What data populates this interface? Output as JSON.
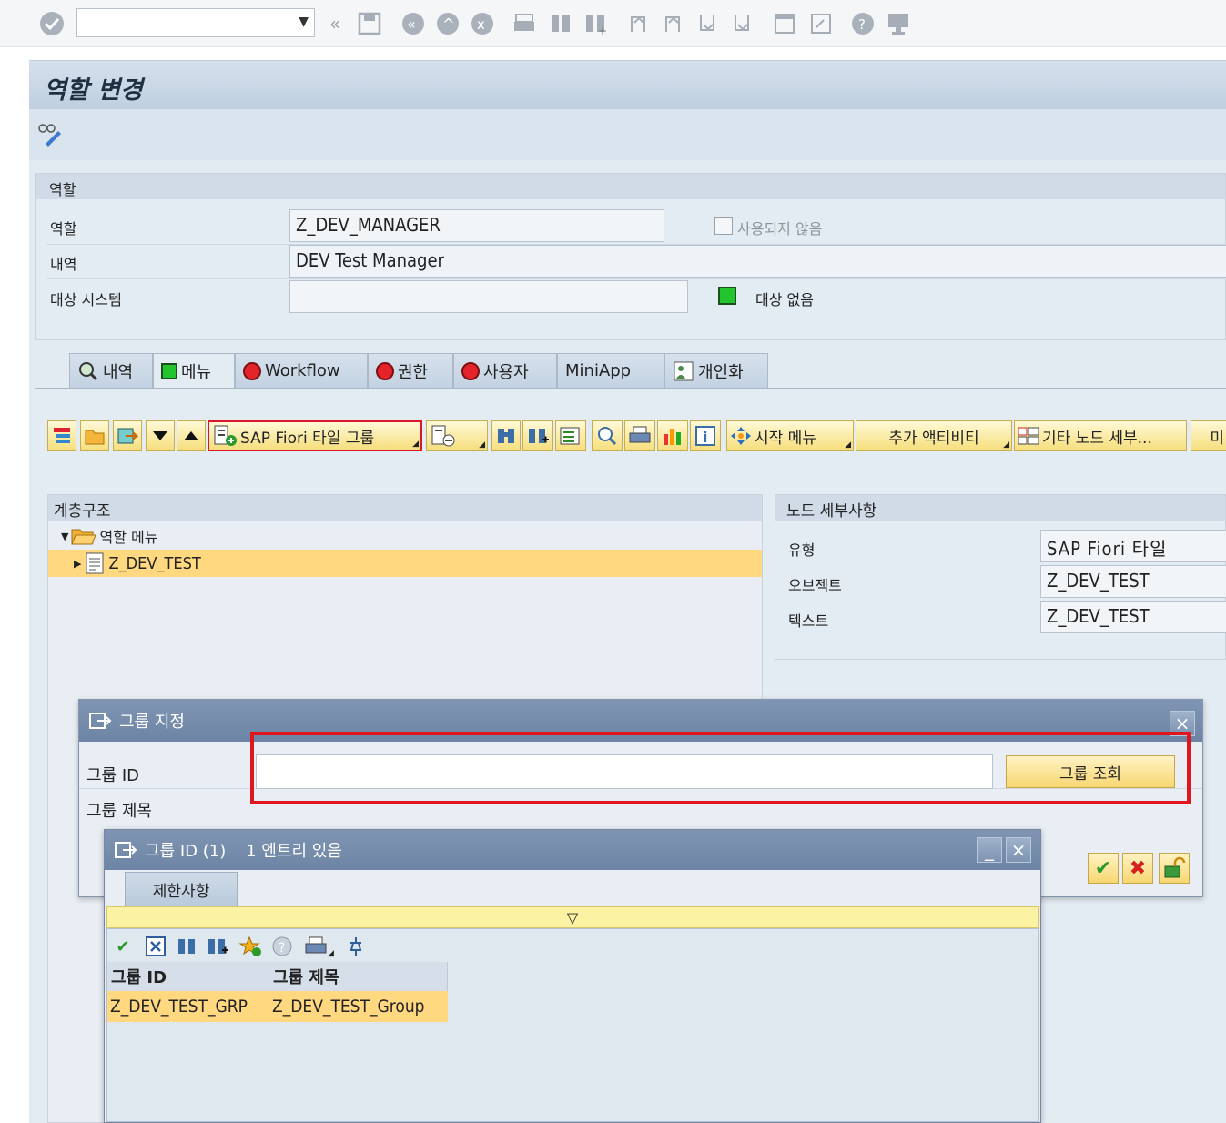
{
  "screen": {
    "title": "역할 변경",
    "command_field_value": ""
  },
  "role_section": {
    "heading": "역할",
    "role_label": "역할",
    "role_value": "Z_DEV_MANAGER",
    "unused_checkbox_label": "사용되지 않음",
    "description_label": "내역",
    "description_value": "DEV Test Manager",
    "target_system_label": "대상 시스템",
    "target_system_value": "",
    "target_status_text": "대상 없음"
  },
  "tabs": [
    {
      "label": "내역"
    },
    {
      "label": "메뉴"
    },
    {
      "label": "Workflow"
    },
    {
      "label": "권한"
    },
    {
      "label": "사용자"
    },
    {
      "label": "MiniApp"
    },
    {
      "label": "개인화"
    }
  ],
  "menu_toolbar": {
    "fiori_group_button": "SAP Fiori 타일 그룹",
    "start_menu_button": "시작 메뉴",
    "additional_activity_button": "추가 액티비티",
    "other_node_button": "기타 노드 세부...",
    "truncated_button": "미"
  },
  "hierarchy": {
    "heading": "계층구조",
    "root_label": "역할 메뉴",
    "child_label": "Z_DEV_TEST"
  },
  "node_details": {
    "heading": "노드 세부사항",
    "type_label": "유형",
    "type_value": "SAP Fiori 타일",
    "object_label": "오브젝트",
    "object_value": "Z_DEV_TEST",
    "text_label": "텍스트",
    "text_value": "Z_DEV_TEST"
  },
  "group_dialog": {
    "title": "그룹 지정",
    "group_id_label": "그룹 ID",
    "group_id_value": "",
    "group_title_label": "그룹 제목",
    "lookup_button": "그룹 조회"
  },
  "result_dialog": {
    "title": "그룹 ID (1)",
    "entries_text": "1 엔트리 있음",
    "restrictions_tab": "제한사항",
    "columns": [
      "그룹 ID",
      "그룹 제목"
    ],
    "rows": [
      [
        "Z_DEV_TEST_GRP",
        "Z_DEV_TEST_Group"
      ]
    ]
  },
  "colors": {
    "highlight_red": "#e0161f",
    "selection_yellow": "#ffd880",
    "status_green": "#22c52e",
    "status_red": "#e4232a"
  }
}
